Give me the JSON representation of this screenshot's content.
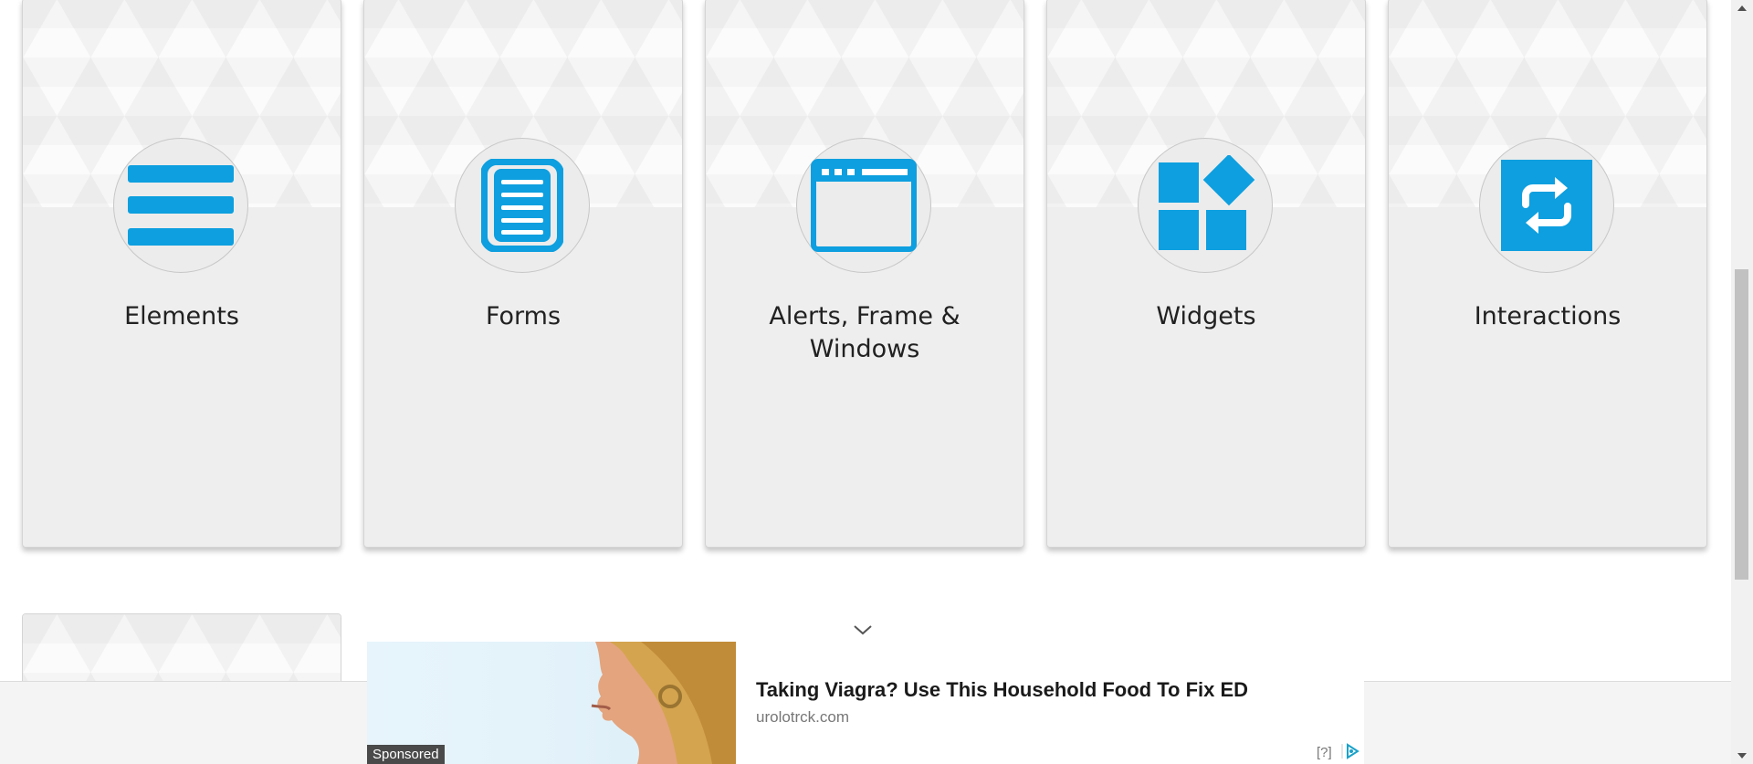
{
  "cards": [
    {
      "title": "Elements",
      "icon": "hamburger-list-icon"
    },
    {
      "title": "Forms",
      "icon": "document-icon"
    },
    {
      "title": "Alerts, Frame & Windows",
      "icon": "browser-window-icon"
    },
    {
      "title": "Widgets",
      "icon": "widgets-icon"
    },
    {
      "title": "Interactions",
      "icon": "repeat-arrows-icon"
    }
  ],
  "colors": {
    "accent": "#0d9fdf",
    "card_bg": "#eeeeee",
    "title": "#212121"
  },
  "ad": {
    "sponsored_label": "Sponsored",
    "headline": "Taking Viagra? Use This Household Food To Fix ED",
    "domain": "urolotrck.com",
    "help_label": "[?]"
  }
}
